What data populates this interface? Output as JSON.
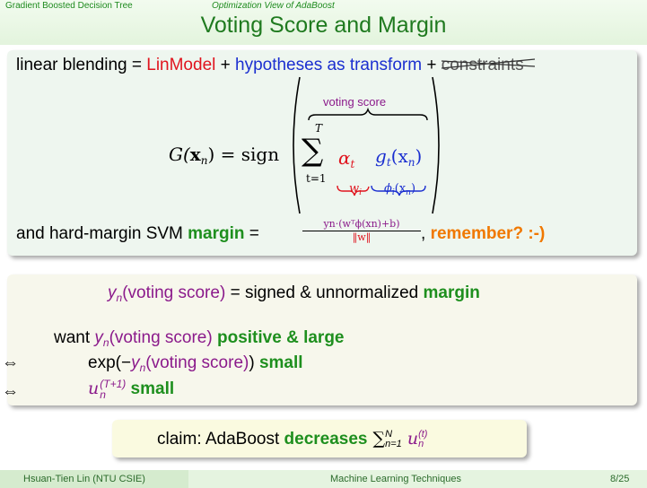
{
  "header": {
    "section": "Gradient Boosted Decision Tree",
    "subsection": "Optimization View of AdaBoost",
    "title": "Voting Score and Margin"
  },
  "box1": {
    "line1_a": "linear blending = ",
    "line1_b": "LinModel",
    "line1_c": " + ",
    "line1_d": "hypotheses as transform",
    "line1_e": " + ",
    "line1_f": "constraints",
    "formula_lhs": "G(",
    "formula_var": "x",
    "formula_sub": "n",
    "formula_eq": ") = sign",
    "voting_label": "voting score",
    "sum_top": "T",
    "sum_bottom": "t=1",
    "alpha": "α",
    "alpha_sub": "t",
    "g": "g",
    "g_sub": "t",
    "g_arg": "(x",
    "g_arg_sub": "n",
    "g_close": ")",
    "w_label": "w",
    "w_sub": "i",
    "phi_label": "ϕ",
    "phi_sub": "i",
    "phi_arg": "(x",
    "phi_arg_sub": "n",
    "phi_close": ")",
    "line3_a": "and hard-margin SVM ",
    "line3_b": "margin",
    "line3_c": " = ",
    "frac_num": "yn·(wᵀϕ(xn)+b)",
    "frac_den": "‖w‖",
    "line3_d": ", ",
    "line3_e": "remember? :-)"
  },
  "box2": {
    "l1_y": "y",
    "l1_sub": "n",
    "l1_a": "(voting score)",
    "l1_b": " = signed & unnormalized ",
    "l1_c": "margin",
    "l2_a": "want ",
    "l2_y": "y",
    "l2_sub": "n",
    "l2_b": "(voting score)",
    "l2_c": " positive & large",
    "iff": "⇔",
    "l3_a": "exp(−",
    "l3_y": "y",
    "l3_sub": "n",
    "l3_b": "(voting score)",
    "l3_c": ")",
    "l3_d": " small",
    "l4_u": "u",
    "l4_sup": "(T+1)",
    "l4_sub": "n",
    "l4_d": " small"
  },
  "box3": {
    "a": "claim: AdaBoost ",
    "b": "decreases",
    "sum": " ∑",
    "sum_sup": "N",
    "sum_sub": "n=1",
    "u": " u",
    "u_sup": "(t)",
    "u_sub": "n"
  },
  "footer": {
    "author": "Hsuan-Tien Lin  (NTU CSIE)",
    "course": "Machine Learning Techniques",
    "page": "8/25"
  }
}
